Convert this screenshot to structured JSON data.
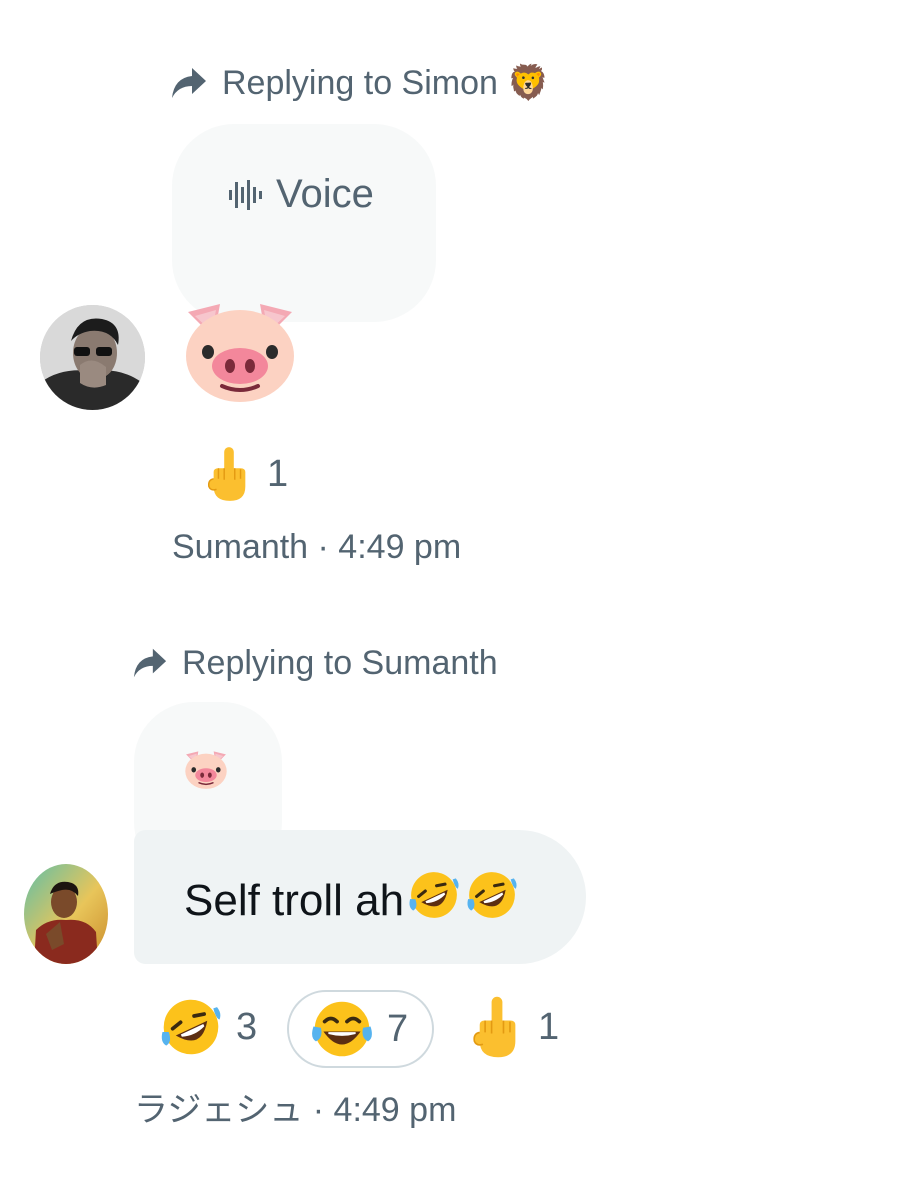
{
  "messages": [
    {
      "replying_to": "Replying to Simon 🦁",
      "quoted": {
        "type": "voice",
        "label": "Voice"
      },
      "content_emoji": "pig-face-emoji",
      "avatar": "avatar-sumanth",
      "reactions": [
        {
          "emoji": "middle-finger-emoji",
          "count": "1",
          "selected": false
        }
      ],
      "meta": "Sumanth · 4:49 pm"
    },
    {
      "replying_to": "Replying to Sumanth",
      "quoted": {
        "type": "emoji",
        "emoji": "pig-face-emoji"
      },
      "text": "Self troll ah",
      "text_emojis": [
        "rofl-emoji",
        "rofl-emoji"
      ],
      "avatar": "avatar-rajesh",
      "reactions": [
        {
          "emoji": "rofl-emoji",
          "count": "3",
          "selected": false
        },
        {
          "emoji": "joy-emoji",
          "count": "7",
          "selected": true
        },
        {
          "emoji": "middle-finger-emoji",
          "count": "1",
          "selected": false
        }
      ],
      "meta": "ラジェシュ · 4:49 pm"
    }
  ],
  "colors": {
    "secondary_text": "#536471",
    "primary_text": "#0f1419",
    "bubble_bg": "#eff3f4",
    "quoted_bg": "#f7f9f9"
  }
}
